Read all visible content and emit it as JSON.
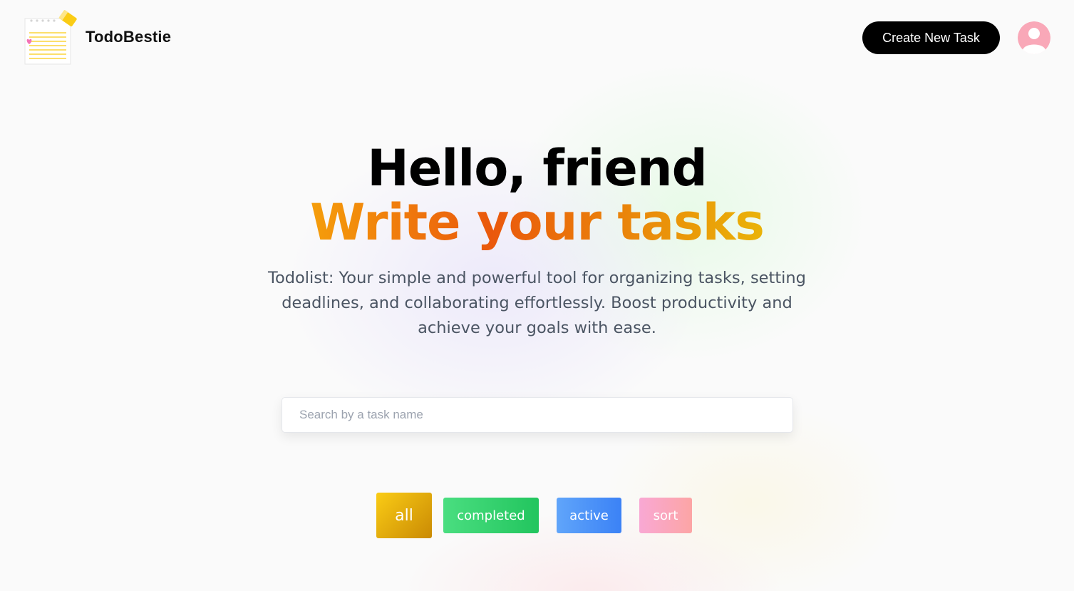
{
  "header": {
    "brand_name": "TodoBestie",
    "create_button_label": "Create New Task"
  },
  "hero": {
    "title": "Hello, friend",
    "subtitle": "Write your tasks",
    "description": "Todolist: Your simple and powerful tool for organizing tasks, setting deadlines, and collaborating effortlessly. Boost productivity and achieve your goals with ease."
  },
  "search": {
    "placeholder": "Search by a task name",
    "value": ""
  },
  "filters": [
    {
      "label": "all",
      "selected": true
    },
    {
      "label": "completed",
      "selected": false
    },
    {
      "label": "active",
      "selected": false
    },
    {
      "label": "sort",
      "selected": false
    }
  ],
  "icons": {
    "logo": "notepad-logo-icon",
    "avatar": "user-avatar-icon"
  },
  "colors": {
    "create_button": "#000000",
    "subtitle_gradient_start": "#f59e0b",
    "subtitle_gradient_end": "#eab308",
    "filter_all": "#eab308",
    "filter_completed": "#22c55e",
    "filter_active": "#3b82f6",
    "filter_sort": "#f9a8d4",
    "avatar": "#f9a8b8"
  }
}
